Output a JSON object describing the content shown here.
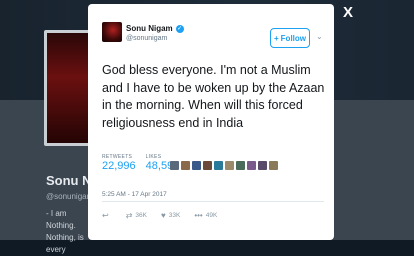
{
  "background_profile": {
    "name": "Sonu Nigam",
    "handle": "@sonunigam",
    "bio_lines": [
      "- I am Nothing.",
      "Nothing, is every"
    ]
  },
  "close_label": "X",
  "tweet": {
    "author_name": "Sonu Nigam",
    "author_handle": "@sonunigam",
    "follow_label": "Follow",
    "text": "God bless everyone. I'm not a Muslim and I have to be woken up by the Azaan in the morning. When will this forced religiousness end in India",
    "stats": {
      "retweets_label": "RETWEETS",
      "retweets_value": "22,996",
      "likes_label": "LIKES",
      "likes_value": "48,596"
    },
    "liker_colors": [
      "#5a6a7a",
      "#8a6a4a",
      "#3a5a8a",
      "#6a4a3a",
      "#2a7a9a",
      "#9a8a6a",
      "#4a6a5a",
      "#7a5a8a",
      "#5a4a6a",
      "#8a7a5a"
    ],
    "timestamp": "5:25 AM - 17 Apr 2017",
    "actions": {
      "reply_count": "",
      "retweet_count": "36K",
      "like_count": "33K",
      "more_count": "49K"
    },
    "colors": {
      "accent": "#1da1f2",
      "text": "#14171a",
      "muted": "#657786"
    }
  }
}
